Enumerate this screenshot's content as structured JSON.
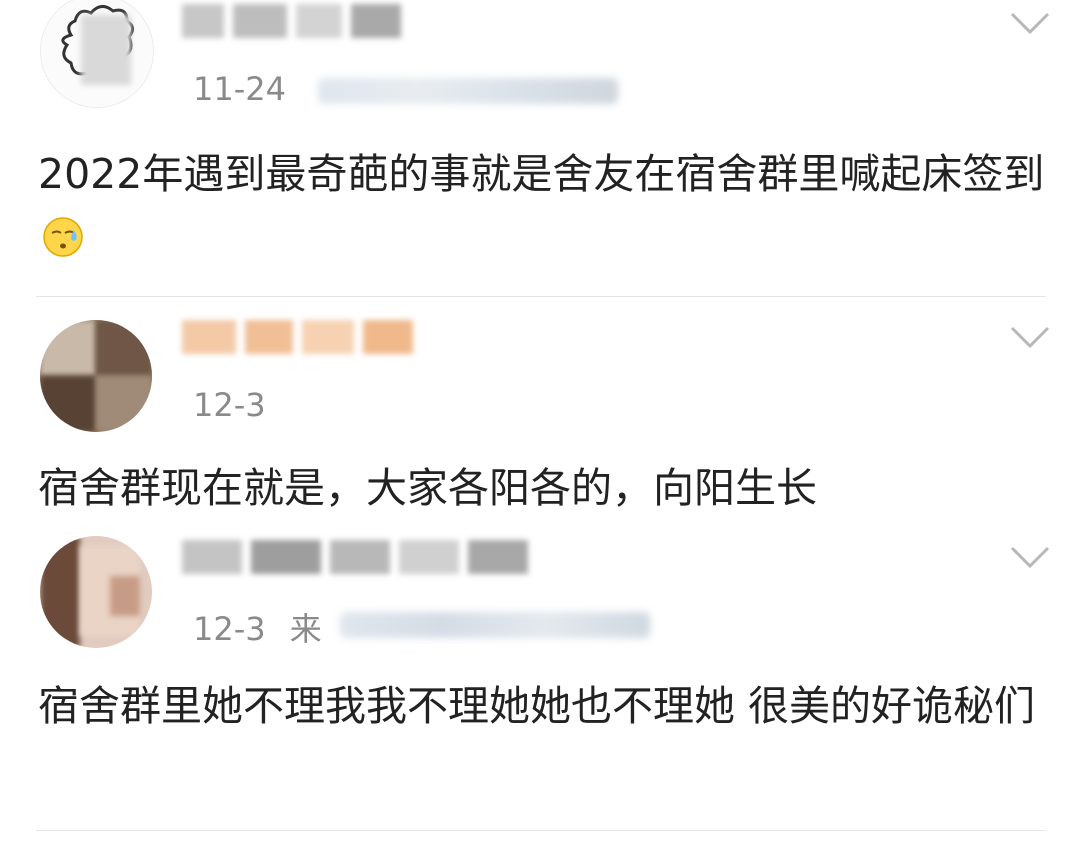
{
  "comments": [
    {
      "date": "11-24",
      "text": "2022年遇到最奇葩的事就是舍友在宿舍群里喊起床签到",
      "emoji": "sweat-emoji"
    },
    {
      "date": "12-3",
      "text": "宿舍群现在就是，大家各阳各的，向阳生长"
    },
    {
      "date": "12-3",
      "source_prefix": "来",
      "text": "宿舍群里她不理我我不理她她也不理她 很美的好诡秘们"
    }
  ],
  "icons": {
    "expand": "chevron-down-icon"
  },
  "colors": {
    "date": "#8a8a8a",
    "divider": "#e6e6e6",
    "text": "#222222"
  }
}
